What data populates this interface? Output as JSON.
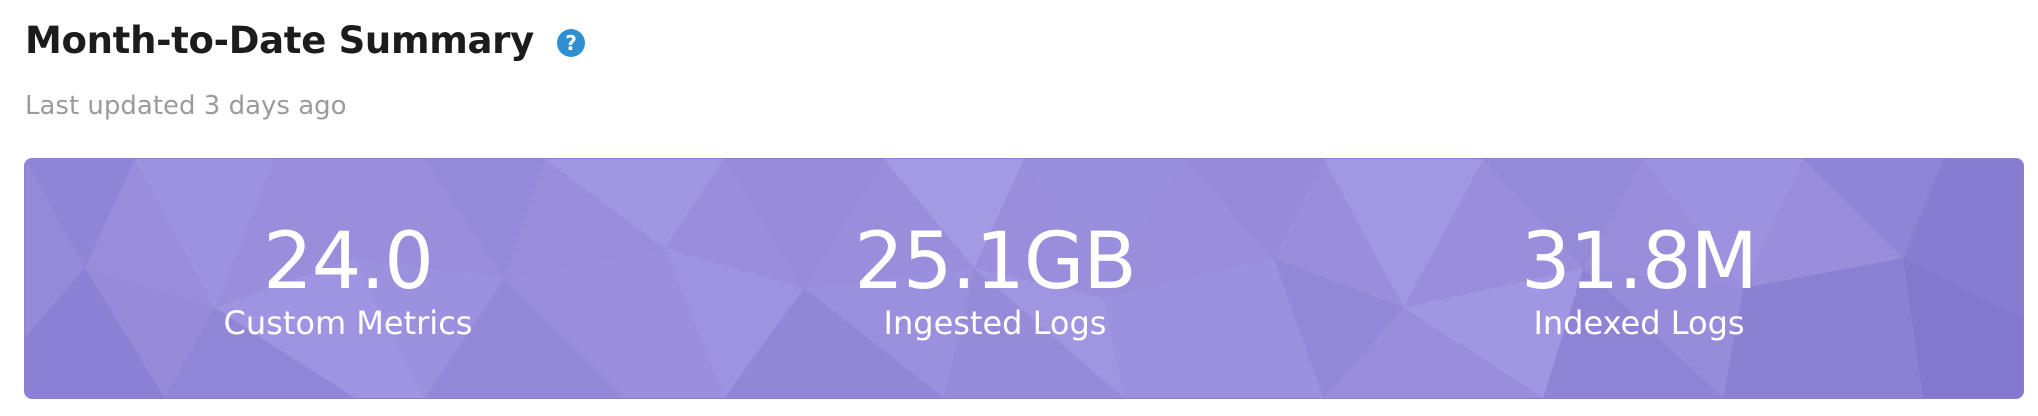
{
  "header": {
    "title": "Month-to-Date Summary",
    "help_icon": "question-circle-icon",
    "help_icon_color": "#2f8fd1",
    "subtitle": "Last updated 3 days ago"
  },
  "panel": {
    "background_color": "#998ddc",
    "metrics": [
      {
        "value": "24.0",
        "label": "Custom Metrics"
      },
      {
        "value": "25.1GB",
        "label": "Ingested Logs"
      },
      {
        "value": "31.8M",
        "label": "Indexed Logs"
      }
    ]
  }
}
